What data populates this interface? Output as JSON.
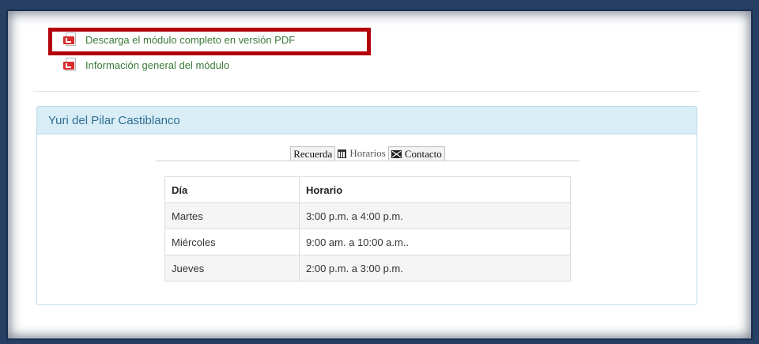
{
  "links": {
    "pdf_download": "Descarga el módulo completo en versión PDF",
    "general_info": "Información general del módulo"
  },
  "panel": {
    "title": "Yuri del Pilar Castiblanco"
  },
  "tabs": {
    "recuerda": "Recuerda",
    "horarios": "Horarios",
    "contacto": "Contacto"
  },
  "schedule": {
    "headers": [
      "Día",
      "Horario"
    ],
    "rows": [
      [
        "Martes",
        "3:00 p.m. a 4:00 p.m."
      ],
      [
        "Miércoles",
        "9:00  am. a 10:00 a.m.."
      ],
      [
        "Jueves",
        "2:00 p.m. a 3:00 p.m."
      ]
    ]
  },
  "colors": {
    "link_green": "#3a7a3a",
    "panel_header_bg": "#d9edf7",
    "panel_title": "#2f6e91",
    "highlight_red": "#b3000a",
    "frame_navy": "#263f63"
  },
  "icons": {
    "pdf": "pdf-icon",
    "calendar": "calendar-icon",
    "mail": "envelope-icon"
  }
}
